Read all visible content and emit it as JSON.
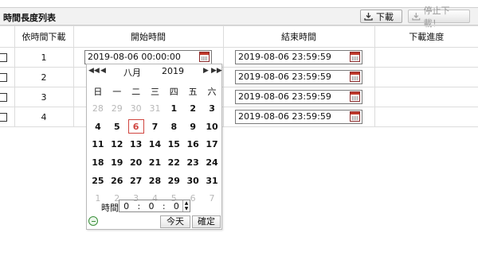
{
  "panel": {
    "title": "時間長度列表",
    "download_label": "下載",
    "stop_label": "停止下載！"
  },
  "table": {
    "headers": [
      "依時間下載",
      "開始時間",
      "結束時間",
      "下載進度"
    ],
    "rows": [
      {
        "index": "1",
        "start": "2019-08-06 00:00:00",
        "end": "2019-08-06 23:59:59",
        "progress": ""
      },
      {
        "index": "2",
        "start": "",
        "end": "2019-08-06 23:59:59",
        "progress": ""
      },
      {
        "index": "3",
        "start": "",
        "end": "2019-08-06 23:59:59",
        "progress": ""
      },
      {
        "index": "4",
        "start": "",
        "end": "2019-08-06 23:59:59",
        "progress": ""
      }
    ]
  },
  "datepicker": {
    "month": "八月",
    "year": "2019",
    "weekdays": [
      "日",
      "一",
      "二",
      "三",
      "四",
      "五",
      "六"
    ],
    "weeks": [
      [
        "28",
        "29",
        "30",
        "31",
        "1",
        "2",
        "3"
      ],
      [
        "4",
        "5",
        "6",
        "7",
        "8",
        "9",
        "10"
      ],
      [
        "11",
        "12",
        "13",
        "14",
        "15",
        "16",
        "17"
      ],
      [
        "18",
        "19",
        "20",
        "21",
        "22",
        "23",
        "24"
      ],
      [
        "25",
        "26",
        "27",
        "28",
        "29",
        "30",
        "31"
      ],
      [
        "1",
        "2",
        "3",
        "4",
        "5",
        "6",
        "7"
      ]
    ],
    "selected_day": "6",
    "time_label": "時間",
    "time_hour": "0",
    "time_minute": "0",
    "time_second": "0",
    "today_label": "今天",
    "confirm_label": "確定"
  }
}
